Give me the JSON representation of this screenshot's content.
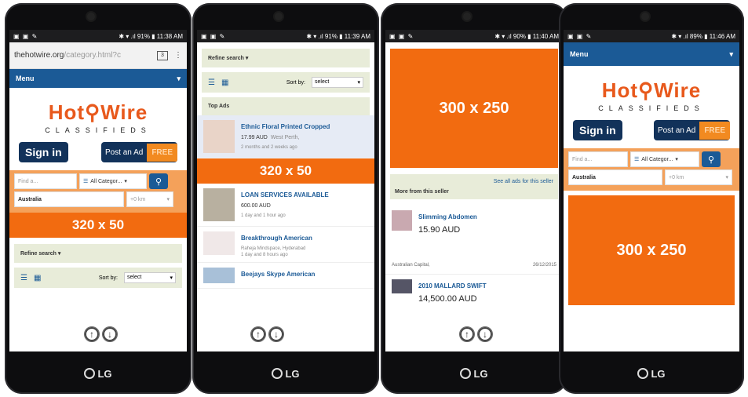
{
  "phones": [
    {
      "status_left": "▣ ▣ ✎",
      "status_right": "✱ ▾ .ıl 91% ▮ 11:38 AM"
    },
    {
      "status_left": "▣ ▣ ✎",
      "status_right": "✱ ▾ .ıl 91% ▮ 11:39 AM"
    },
    {
      "status_left": "▣ ▣ ✎",
      "status_right": "✱ ▾ .ıl 90% ▮ 11:40 AM"
    },
    {
      "status_left": "▣ ▣ ✎",
      "status_right": "✱ ▾ .ıl 89% ▮ 11:46 AM"
    }
  ],
  "brand_badge": "LG",
  "browser": {
    "host": "thehotwire.org",
    "path": "/category.html?c",
    "tabs": "3"
  },
  "menu_label": "Menu",
  "brand": {
    "name": "Hot⚲Wire",
    "sub": "CLASSIFIEDS"
  },
  "signin": "Sign in",
  "post_ad": "Post an Ad",
  "free": "FREE",
  "search": {
    "find_placeholder": "Find a...",
    "category": "All Categor...",
    "category_short": "All Categor...",
    "location": "Australia",
    "radius": "+0 km"
  },
  "ad_320": "320 x 50",
  "ad_300": "300 x 250",
  "refine": "Refine search",
  "sort_label": "Sort by:",
  "sort_value": "select",
  "top_ads": "Top Ads",
  "ads": [
    {
      "title": "Ethnic Floral Printed Cropped",
      "price": "17.99 AUD",
      "loc": "West Perth,",
      "when": "2 months and 2 weeks ago"
    },
    {
      "title": "LOAN SERVICES AVAILABLE",
      "price": "600.00 AUD",
      "loc": "",
      "when": "1 day and 1 hour ago"
    },
    {
      "title": "Breakthrough American",
      "price": "Raheja Mindspace, Hyderabad",
      "loc": "",
      "when": "1 day and 8 hours ago"
    },
    {
      "title": "Beejays Skype American",
      "price": "",
      "loc": "",
      "when": ""
    }
  ],
  "seller": {
    "link": "See all ads for this seller",
    "title": "More from this seller"
  },
  "seller_ads": [
    {
      "title": "Slimming Abdomen",
      "price": "15.90 AUD",
      "loc": "Australian Capital,",
      "date": "26/12/2015"
    },
    {
      "title": "2010 MALLARD SWIFT",
      "price": "14,500.00 AUD"
    }
  ]
}
